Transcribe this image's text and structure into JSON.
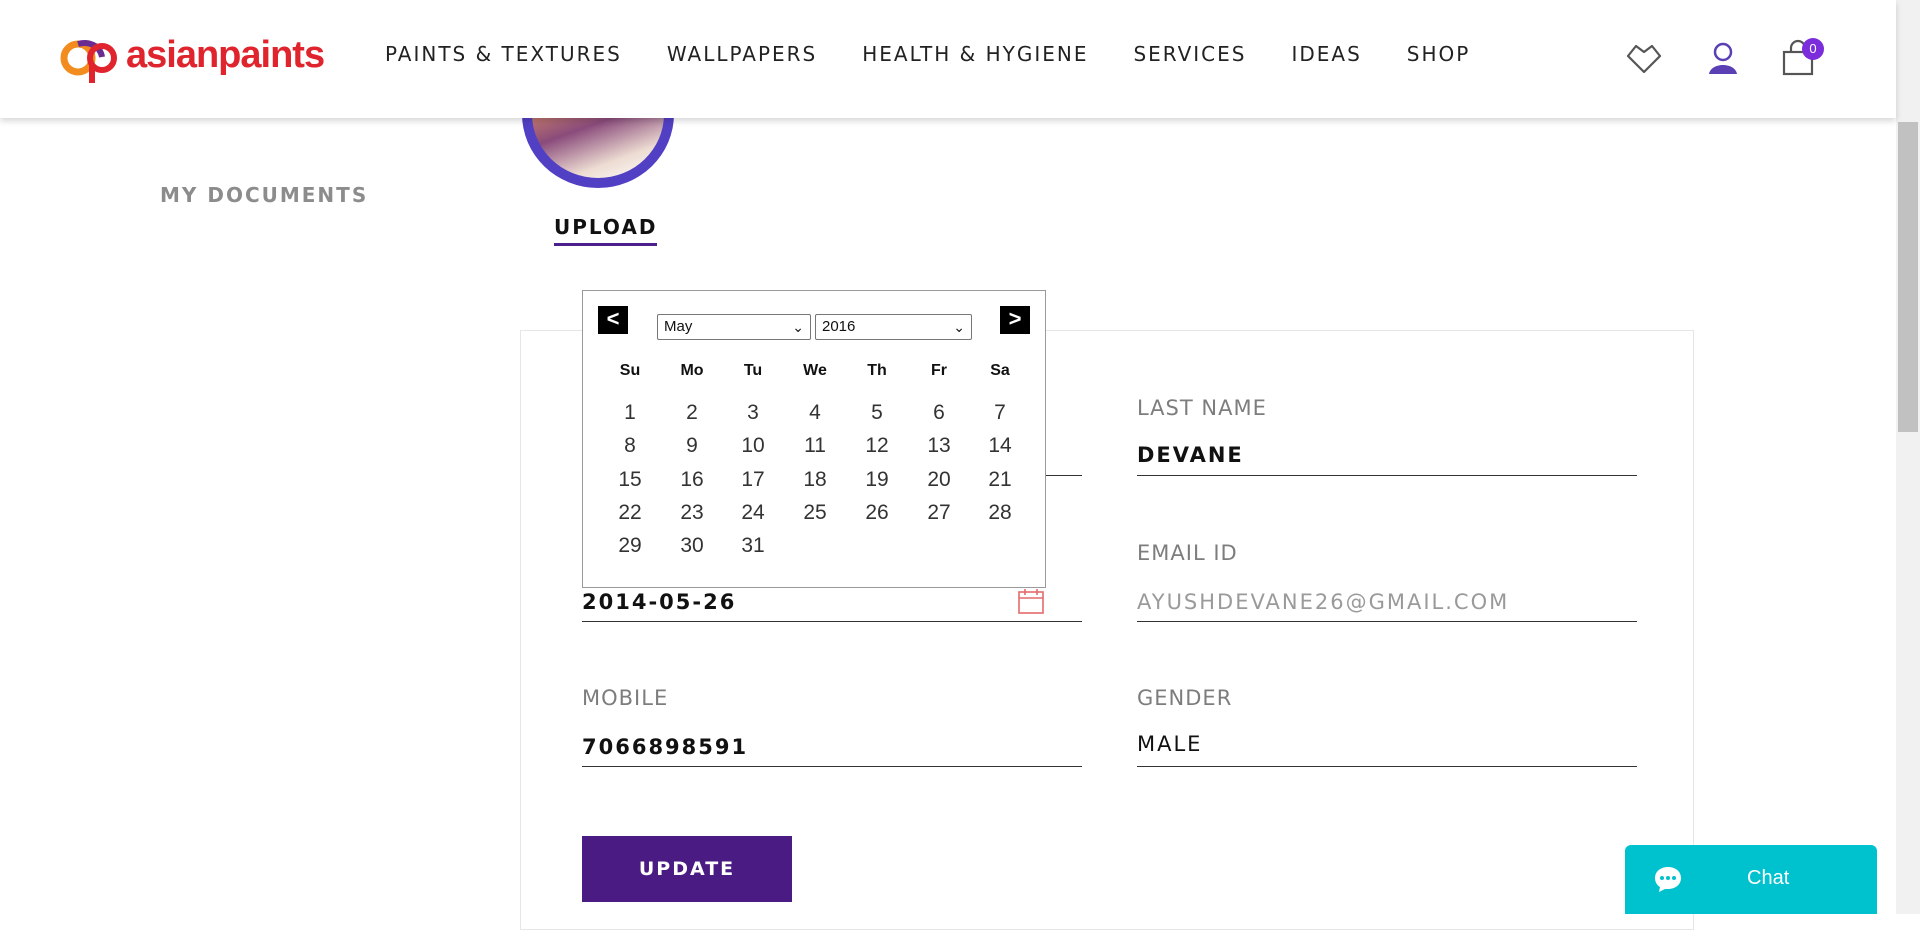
{
  "brand": {
    "name": "asianpaints",
    "accent": "#4a1c83",
    "red": "#e0242d"
  },
  "nav": {
    "items": [
      "PAINTS & TEXTURES",
      "WALLPAPERS",
      "HEALTH & HYGIENE",
      "SERVICES",
      "IDEAS",
      "SHOP"
    ],
    "cart_count": "0",
    "icons": [
      "wishlist-heart-icon",
      "user-account-icon",
      "cart-icon"
    ]
  },
  "sidebar": {
    "my_documents": "MY DOCUMENTS"
  },
  "profile": {
    "upload_label": "UPLOAD"
  },
  "form": {
    "last_name_label": "LAST NAME",
    "last_name_value": "DEVANE",
    "email_label": "EMAIL ID",
    "email_value": "AYUSHDEVANE26@GMAIL.COM",
    "dob_value": "2014-05-26",
    "mobile_label": "MOBILE",
    "mobile_value": "7066898591",
    "gender_label": "GENDER",
    "gender_value": "MALE",
    "update_label": "UPDATE"
  },
  "datepicker": {
    "prev": "<",
    "next": ">",
    "month": "May",
    "year": "2016",
    "weekdays": [
      "Su",
      "Mo",
      "Tu",
      "We",
      "Th",
      "Fr",
      "Sa"
    ],
    "days": [
      [
        "1",
        "2",
        "3",
        "4",
        "5",
        "6",
        "7"
      ],
      [
        "8",
        "9",
        "10",
        "11",
        "12",
        "13",
        "14"
      ],
      [
        "15",
        "16",
        "17",
        "18",
        "19",
        "20",
        "21"
      ],
      [
        "22",
        "23",
        "24",
        "25",
        "26",
        "27",
        "28"
      ],
      [
        "29",
        "30",
        "31"
      ]
    ]
  },
  "chat": {
    "label": "Chat"
  }
}
